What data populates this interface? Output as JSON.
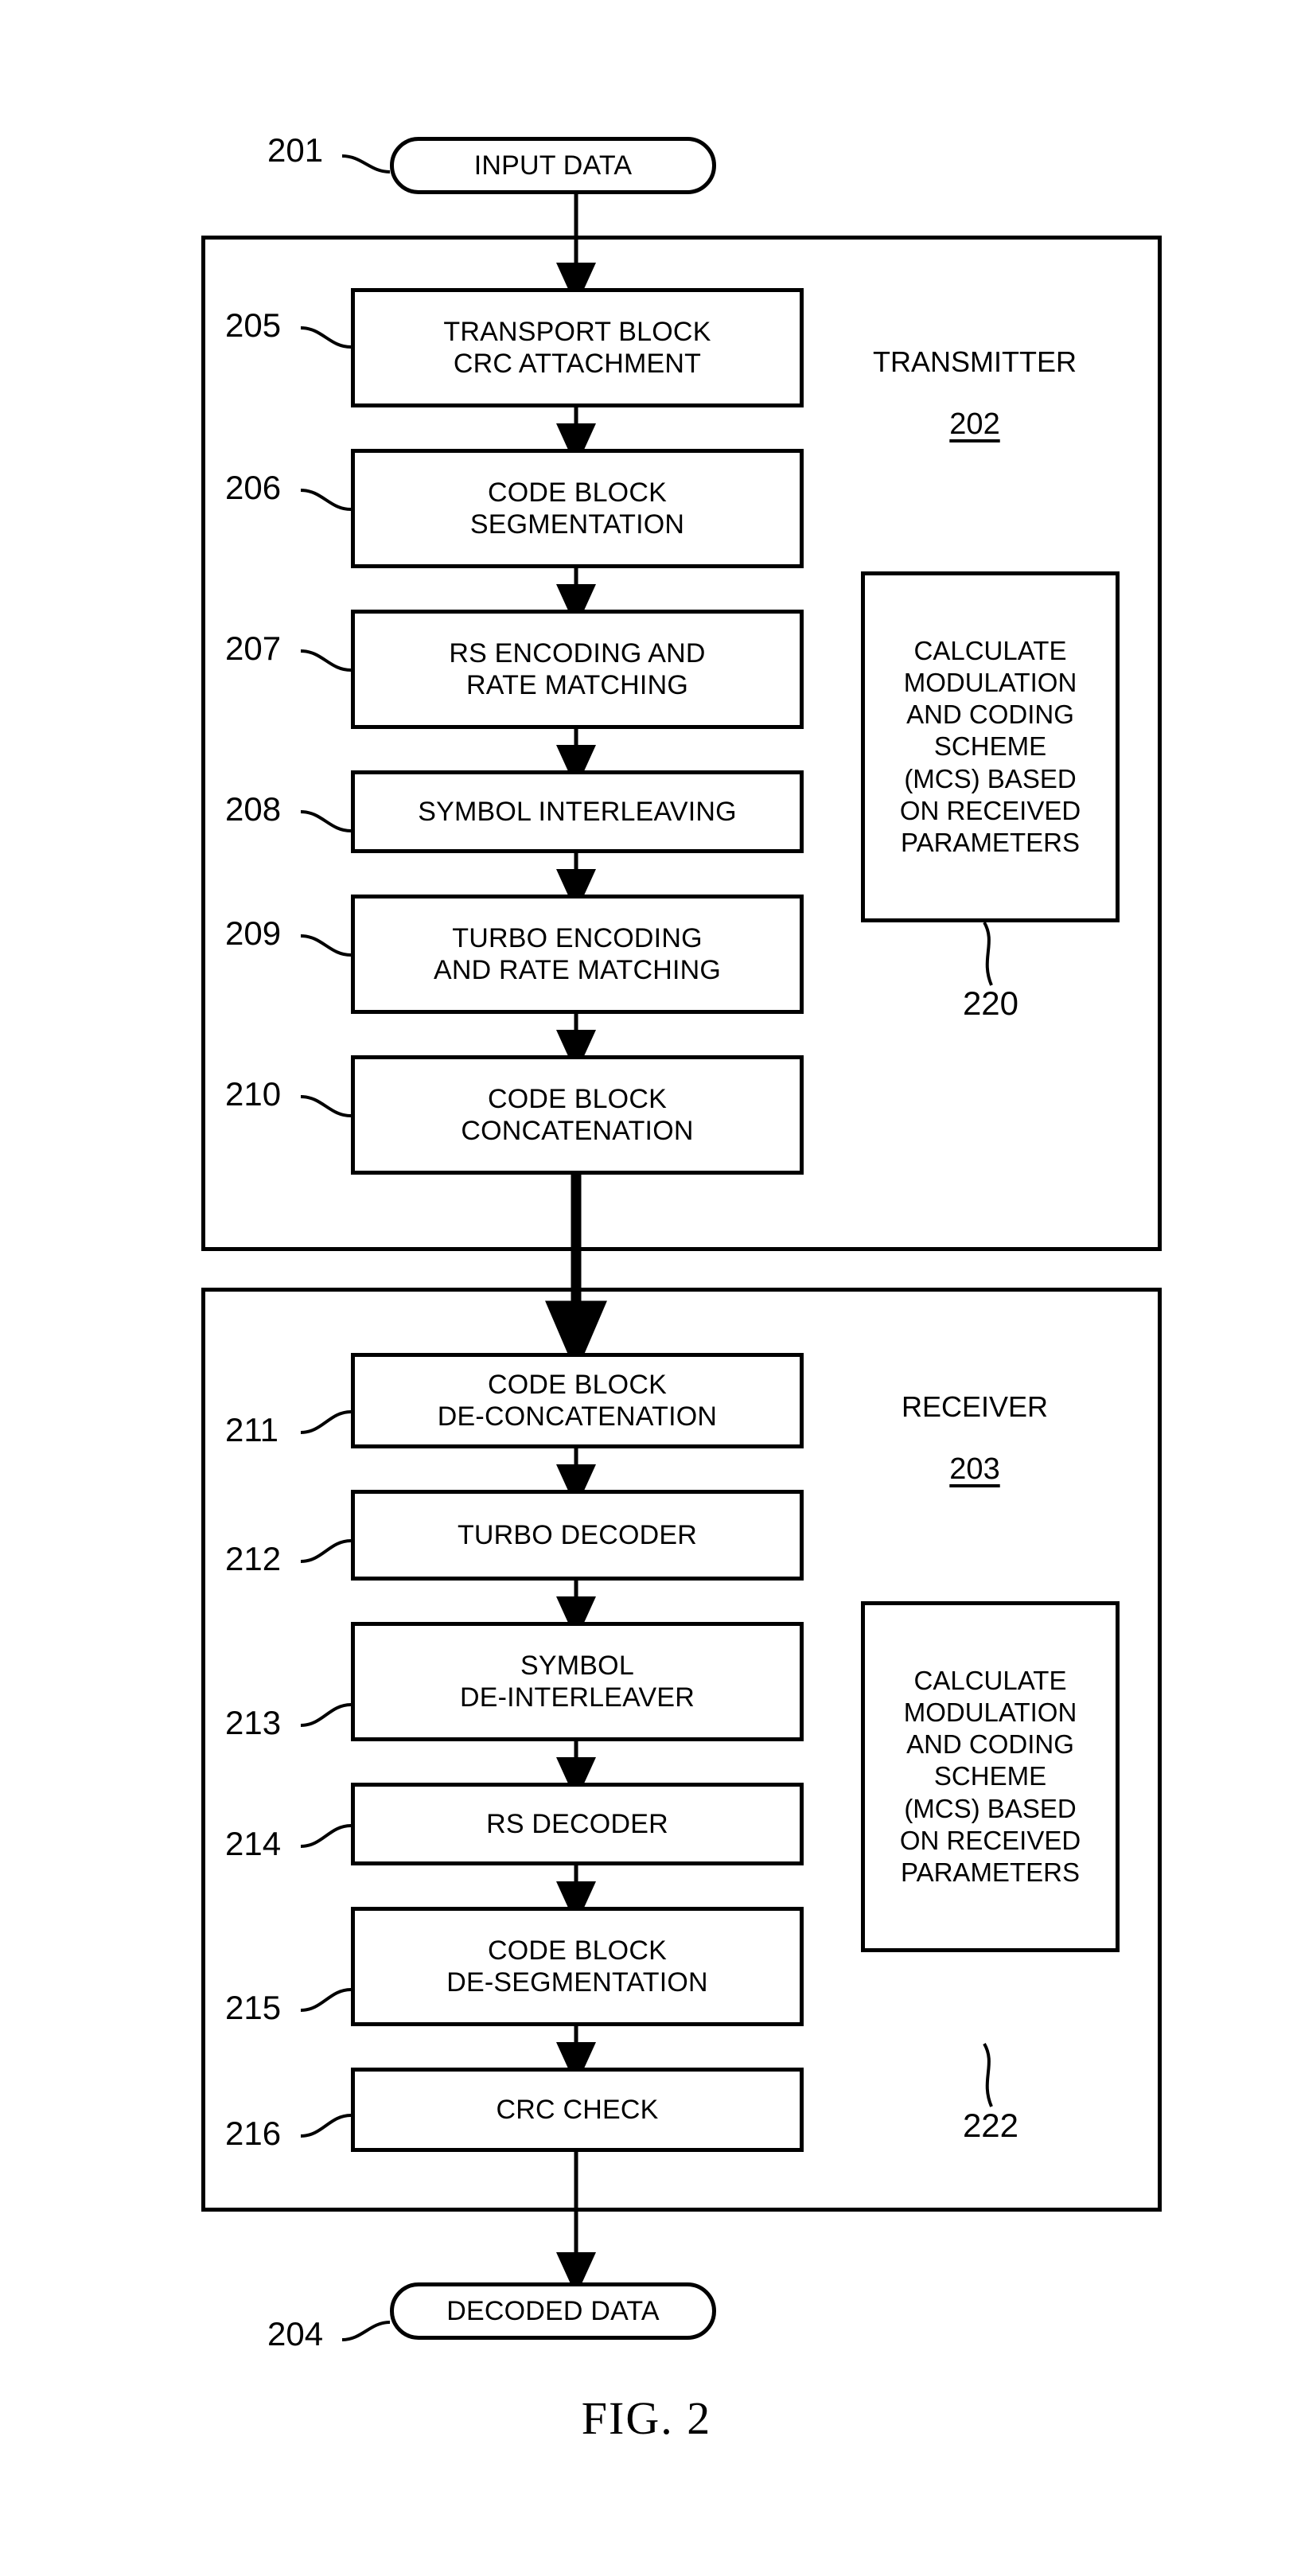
{
  "figure": {
    "caption": "FIG. 2",
    "input_terminal": {
      "label": "INPUT DATA",
      "ref": "201"
    },
    "output_terminal": {
      "label": "DECODED DATA",
      "ref": "204"
    },
    "sections": [
      {
        "name": "transmitter",
        "title": "TRANSMITTER",
        "ref": "202",
        "steps": [
          {
            "ref": "205",
            "line1": "TRANSPORT BLOCK",
            "line2": "CRC ATTACHMENT"
          },
          {
            "ref": "206",
            "line1": "CODE BLOCK",
            "line2": "SEGMENTATION"
          },
          {
            "ref": "207",
            "line1": "RS ENCODING AND",
            "line2": "RATE MATCHING"
          },
          {
            "ref": "208",
            "line1": "SYMBOL INTERLEAVING",
            "line2": ""
          },
          {
            "ref": "209",
            "line1": "TURBO ENCODING",
            "line2": "AND RATE MATCHING"
          },
          {
            "ref": "210",
            "line1": "CODE BLOCK",
            "line2": "CONCATENATION"
          }
        ],
        "side_box": {
          "ref": "220",
          "lines": [
            "CALCULATE",
            "MODULATION",
            "AND CODING",
            "SCHEME",
            "(MCS) BASED",
            "ON RECEIVED",
            "PARAMETERS"
          ]
        }
      },
      {
        "name": "receiver",
        "title": "RECEIVER",
        "ref": "203",
        "steps": [
          {
            "ref": "211",
            "line1": "CODE BLOCK",
            "line2": "DE-CONCATENATION"
          },
          {
            "ref": "212",
            "line1": "TURBO DECODER",
            "line2": ""
          },
          {
            "ref": "213",
            "line1": "SYMBOL",
            "line2": "DE-INTERLEAVER"
          },
          {
            "ref": "214",
            "line1": "RS DECODER",
            "line2": ""
          },
          {
            "ref": "215",
            "line1": "CODE BLOCK",
            "line2": "DE-SEGMENTATION"
          },
          {
            "ref": "216",
            "line1": "CRC CHECK",
            "line2": ""
          }
        ],
        "side_box": {
          "ref": "222",
          "lines": [
            "CALCULATE",
            "MODULATION",
            "AND CODING",
            "SCHEME",
            "(MCS) BASED",
            "ON RECEIVED",
            "PARAMETERS"
          ]
        }
      }
    ],
    "colors": {
      "ink": "#000000",
      "paper": "#ffffff"
    }
  }
}
